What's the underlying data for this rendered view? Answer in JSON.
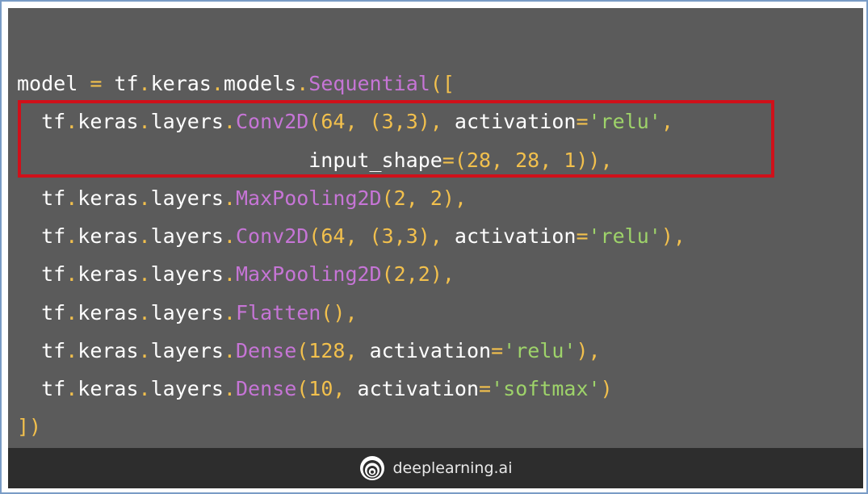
{
  "code": {
    "lines": [
      [
        {
          "t": "model ",
          "c": "kw"
        },
        {
          "t": "=",
          "c": "op"
        },
        {
          "t": " tf",
          "c": "kw"
        },
        {
          "t": ".",
          "c": "op"
        },
        {
          "t": "keras",
          "c": "kw"
        },
        {
          "t": ".",
          "c": "op"
        },
        {
          "t": "models",
          "c": "kw"
        },
        {
          "t": ".",
          "c": "op"
        },
        {
          "t": "Sequential",
          "c": "fn"
        },
        {
          "t": "([",
          "c": "op"
        }
      ],
      [
        {
          "t": "  tf",
          "c": "kw"
        },
        {
          "t": ".",
          "c": "op"
        },
        {
          "t": "keras",
          "c": "kw"
        },
        {
          "t": ".",
          "c": "op"
        },
        {
          "t": "layers",
          "c": "kw"
        },
        {
          "t": ".",
          "c": "op"
        },
        {
          "t": "Conv2D",
          "c": "fn"
        },
        {
          "t": "(64, (3,3), ",
          "c": "op"
        },
        {
          "t": "activation",
          "c": "kw"
        },
        {
          "t": "=",
          "c": "op"
        },
        {
          "t": "'relu'",
          "c": "str"
        },
        {
          "t": ",",
          "c": "op"
        }
      ],
      [
        {
          "t": "                        input_shape",
          "c": "kw"
        },
        {
          "t": "=(28, 28, 1)),",
          "c": "op"
        }
      ],
      [
        {
          "t": "  tf",
          "c": "kw"
        },
        {
          "t": ".",
          "c": "op"
        },
        {
          "t": "keras",
          "c": "kw"
        },
        {
          "t": ".",
          "c": "op"
        },
        {
          "t": "layers",
          "c": "kw"
        },
        {
          "t": ".",
          "c": "op"
        },
        {
          "t": "MaxPooling2D",
          "c": "fn"
        },
        {
          "t": "(2, 2),",
          "c": "op"
        }
      ],
      [
        {
          "t": "  tf",
          "c": "kw"
        },
        {
          "t": ".",
          "c": "op"
        },
        {
          "t": "keras",
          "c": "kw"
        },
        {
          "t": ".",
          "c": "op"
        },
        {
          "t": "layers",
          "c": "kw"
        },
        {
          "t": ".",
          "c": "op"
        },
        {
          "t": "Conv2D",
          "c": "fn"
        },
        {
          "t": "(64, (3,3), ",
          "c": "op"
        },
        {
          "t": "activation",
          "c": "kw"
        },
        {
          "t": "=",
          "c": "op"
        },
        {
          "t": "'relu'",
          "c": "str"
        },
        {
          "t": "),",
          "c": "op"
        }
      ],
      [
        {
          "t": "  tf",
          "c": "kw"
        },
        {
          "t": ".",
          "c": "op"
        },
        {
          "t": "keras",
          "c": "kw"
        },
        {
          "t": ".",
          "c": "op"
        },
        {
          "t": "layers",
          "c": "kw"
        },
        {
          "t": ".",
          "c": "op"
        },
        {
          "t": "MaxPooling2D",
          "c": "fn"
        },
        {
          "t": "(2,2),",
          "c": "op"
        }
      ],
      [
        {
          "t": "  tf",
          "c": "kw"
        },
        {
          "t": ".",
          "c": "op"
        },
        {
          "t": "keras",
          "c": "kw"
        },
        {
          "t": ".",
          "c": "op"
        },
        {
          "t": "layers",
          "c": "kw"
        },
        {
          "t": ".",
          "c": "op"
        },
        {
          "t": "Flatten",
          "c": "fn"
        },
        {
          "t": "(),",
          "c": "op"
        }
      ],
      [
        {
          "t": "  tf",
          "c": "kw"
        },
        {
          "t": ".",
          "c": "op"
        },
        {
          "t": "keras",
          "c": "kw"
        },
        {
          "t": ".",
          "c": "op"
        },
        {
          "t": "layers",
          "c": "kw"
        },
        {
          "t": ".",
          "c": "op"
        },
        {
          "t": "Dense",
          "c": "fn"
        },
        {
          "t": "(128, ",
          "c": "op"
        },
        {
          "t": "activation",
          "c": "kw"
        },
        {
          "t": "=",
          "c": "op"
        },
        {
          "t": "'relu'",
          "c": "str"
        },
        {
          "t": "),",
          "c": "op"
        }
      ],
      [
        {
          "t": "  tf",
          "c": "kw"
        },
        {
          "t": ".",
          "c": "op"
        },
        {
          "t": "keras",
          "c": "kw"
        },
        {
          "t": ".",
          "c": "op"
        },
        {
          "t": "layers",
          "c": "kw"
        },
        {
          "t": ".",
          "c": "op"
        },
        {
          "t": "Dense",
          "c": "fn"
        },
        {
          "t": "(10, ",
          "c": "op"
        },
        {
          "t": "activation",
          "c": "kw"
        },
        {
          "t": "=",
          "c": "op"
        },
        {
          "t": "'softmax'",
          "c": "str"
        },
        {
          "t": ")",
          "c": "op"
        }
      ],
      [
        {
          "t": "])",
          "c": "op"
        }
      ]
    ]
  },
  "footer": {
    "brand": "deeplearning.ai",
    "logo_icon": "deeplearning-logo-icon"
  },
  "colors": {
    "slide_background": "#5b5b5b",
    "footer_background": "#2d2d2d",
    "highlight_border": "#d0101a",
    "identifier": "#ffffff",
    "punctuation_number": "#f2c04d",
    "function_name": "#c675d6",
    "string": "#9ed36a"
  }
}
